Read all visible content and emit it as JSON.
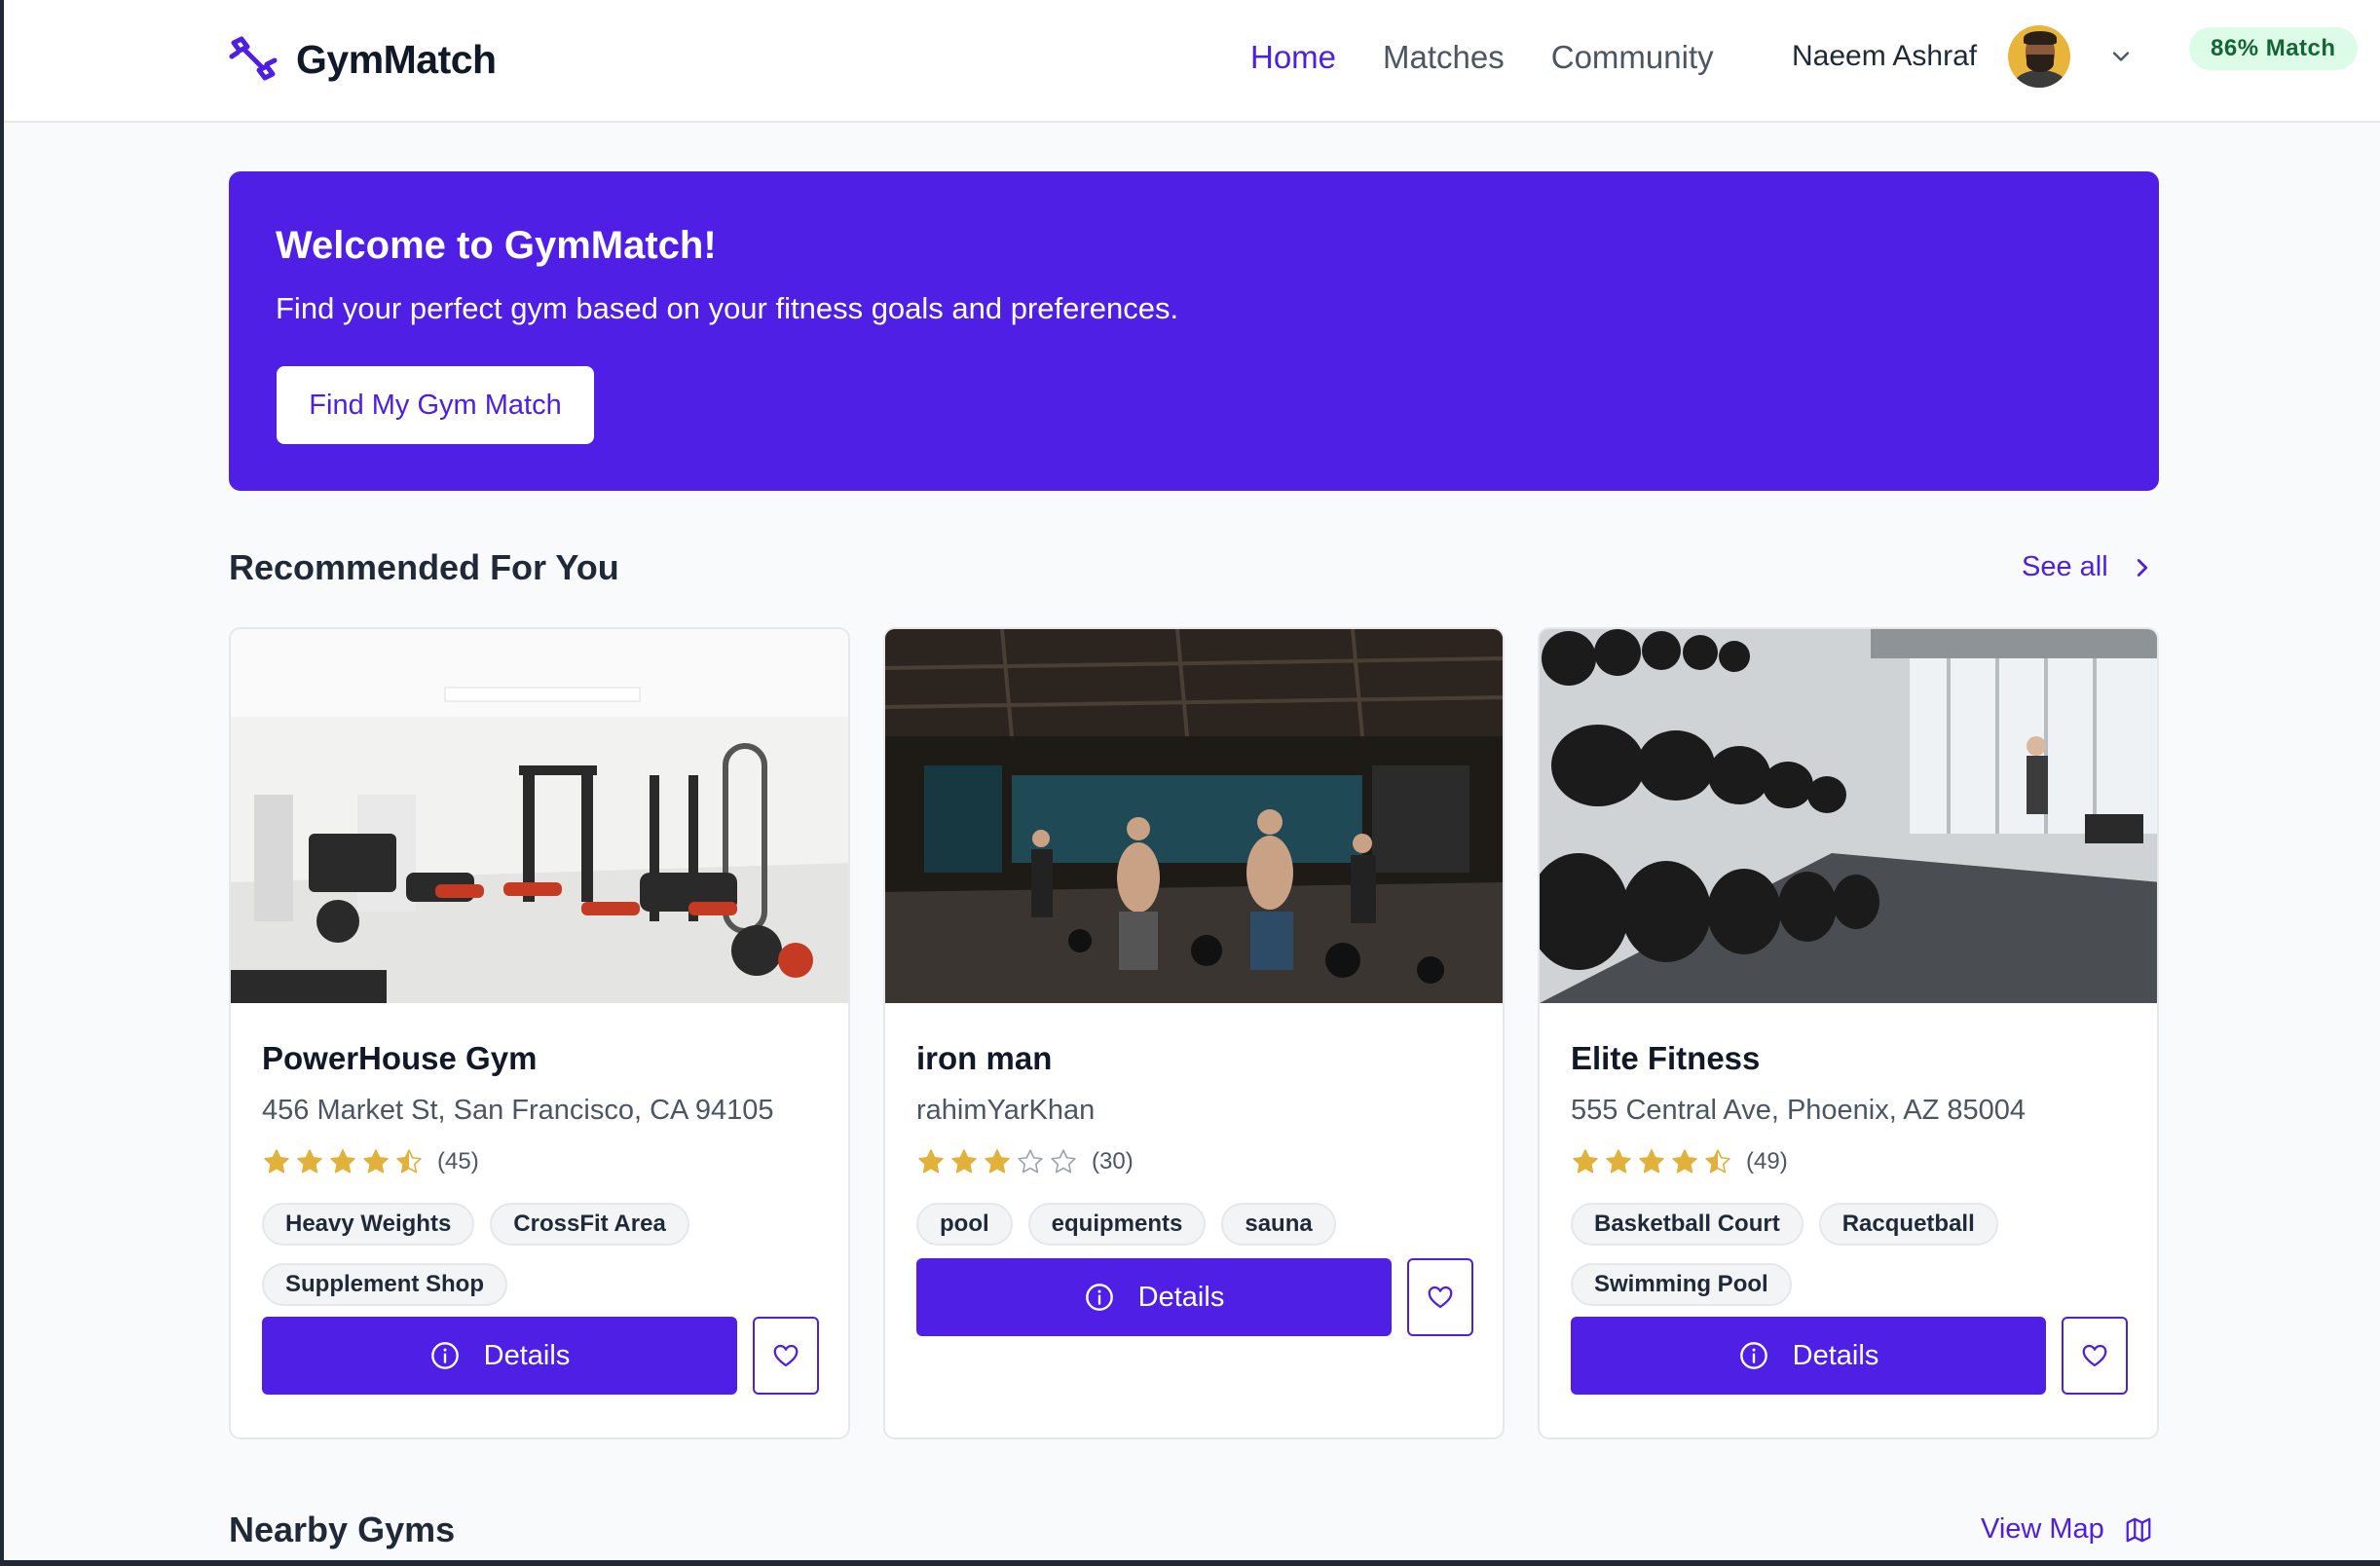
{
  "colors": {
    "brand": "#4f1fe6",
    "match_badge_bg": "#dcfce7",
    "match_badge_text": "#166534",
    "star": "#e2b13c"
  },
  "header": {
    "app_name": "GymMatch",
    "nav": [
      {
        "label": "Home",
        "active": true
      },
      {
        "label": "Matches",
        "active": false
      },
      {
        "label": "Community",
        "active": false
      }
    ],
    "user_name": "Naeem Ashraf",
    "match_badge": "86% Match"
  },
  "hero": {
    "title": "Welcome to GymMatch!",
    "subtitle": "Find your perfect gym based on your fitness goals and preferences.",
    "cta": "Find My Gym Match"
  },
  "recommended": {
    "title": "Recommended For You",
    "see_all": "See all",
    "cards": [
      {
        "name": "PowerHouse Gym",
        "address": "456 Market St, San Francisco, CA 94105",
        "rating": 4.5,
        "reviews": "(45)",
        "tags": [
          "Heavy Weights",
          "CrossFit Area",
          "Supplement Shop"
        ],
        "details_label": "Details"
      },
      {
        "name": "iron man",
        "address": "rahimYarKhan",
        "rating": 3,
        "reviews": "(30)",
        "tags": [
          "pool",
          "equipments",
          "sauna"
        ],
        "details_label": "Details"
      },
      {
        "name": "Elite Fitness",
        "address": "555 Central Ave, Phoenix, AZ 85004",
        "rating": 4.5,
        "reviews": "(49)",
        "tags": [
          "Basketball Court",
          "Racquetball",
          "Swimming Pool"
        ],
        "details_label": "Details"
      }
    ]
  },
  "nearby": {
    "title": "Nearby Gyms",
    "view_map": "View Map"
  }
}
